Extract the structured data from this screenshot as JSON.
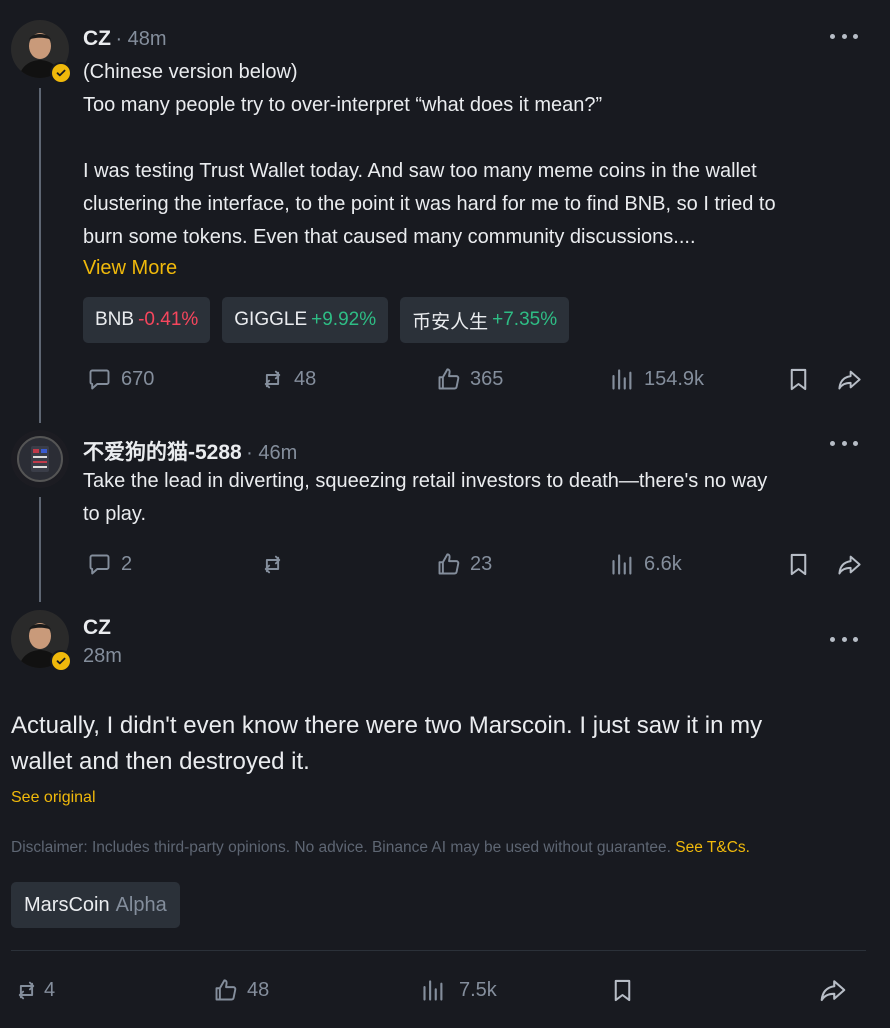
{
  "posts": [
    {
      "author": "CZ",
      "time": "· 48m",
      "lines": [
        "(Chinese version below)",
        "Too many people try to over-interpret “what does it mean?”",
        "",
        "I was testing Trust Wallet today. And saw too many meme coins in the wallet",
        "clustering the interface, to the point it was hard for me to find BNB, so I tried to",
        "burn some tokens. Even that caused many community discussions...."
      ],
      "view_more": "View More",
      "tickers": [
        {
          "symbol": "BNB",
          "change": "-0.41%",
          "direction": "down"
        },
        {
          "symbol": "GIGGLE",
          "change": "+9.92%",
          "direction": "up"
        },
        {
          "symbol": "币安人生",
          "change": "+7.35%",
          "direction": "up"
        }
      ],
      "stats": {
        "comments": "670",
        "reposts": "48",
        "likes": "365",
        "views": "154.9k"
      }
    },
    {
      "author": "不爱狗的猫-5288",
      "time": "· 46m",
      "lines": [
        "Take the lead in diverting, squeezing retail investors to death—there's no way",
        "to play."
      ],
      "stats": {
        "comments": "2",
        "reposts": "",
        "likes": "23",
        "views": "6.6k"
      }
    },
    {
      "author": "CZ",
      "time": "28m",
      "lines": [
        "Actually, I didn't even know there were two Marscoin. I just saw it in my",
        "wallet and then destroyed it."
      ],
      "see_original": "See original",
      "disclaimer": "Disclaimer: Includes third-party opinions. No advice. Binance AI may be used without guarantee.",
      "disclaimer_link": "See T&Cs.",
      "coin": {
        "name": "MarsCoin",
        "type": "Alpha"
      },
      "stats": {
        "reposts": "4",
        "likes": "48",
        "views": "7.5k"
      }
    }
  ],
  "icons": {
    "comment": "comment-icon",
    "repost": "repost-icon",
    "like": "thumbs-up-icon",
    "views": "views-bar-icon",
    "bookmark": "bookmark-icon",
    "share": "share-icon",
    "more": "more-dots-icon",
    "verified": "verified-badge-icon"
  },
  "colors": {
    "background": "#181a20",
    "accent": "#f0b90b",
    "up": "#2ebd85",
    "down": "#f6465d",
    "muted": "#848e9c"
  }
}
